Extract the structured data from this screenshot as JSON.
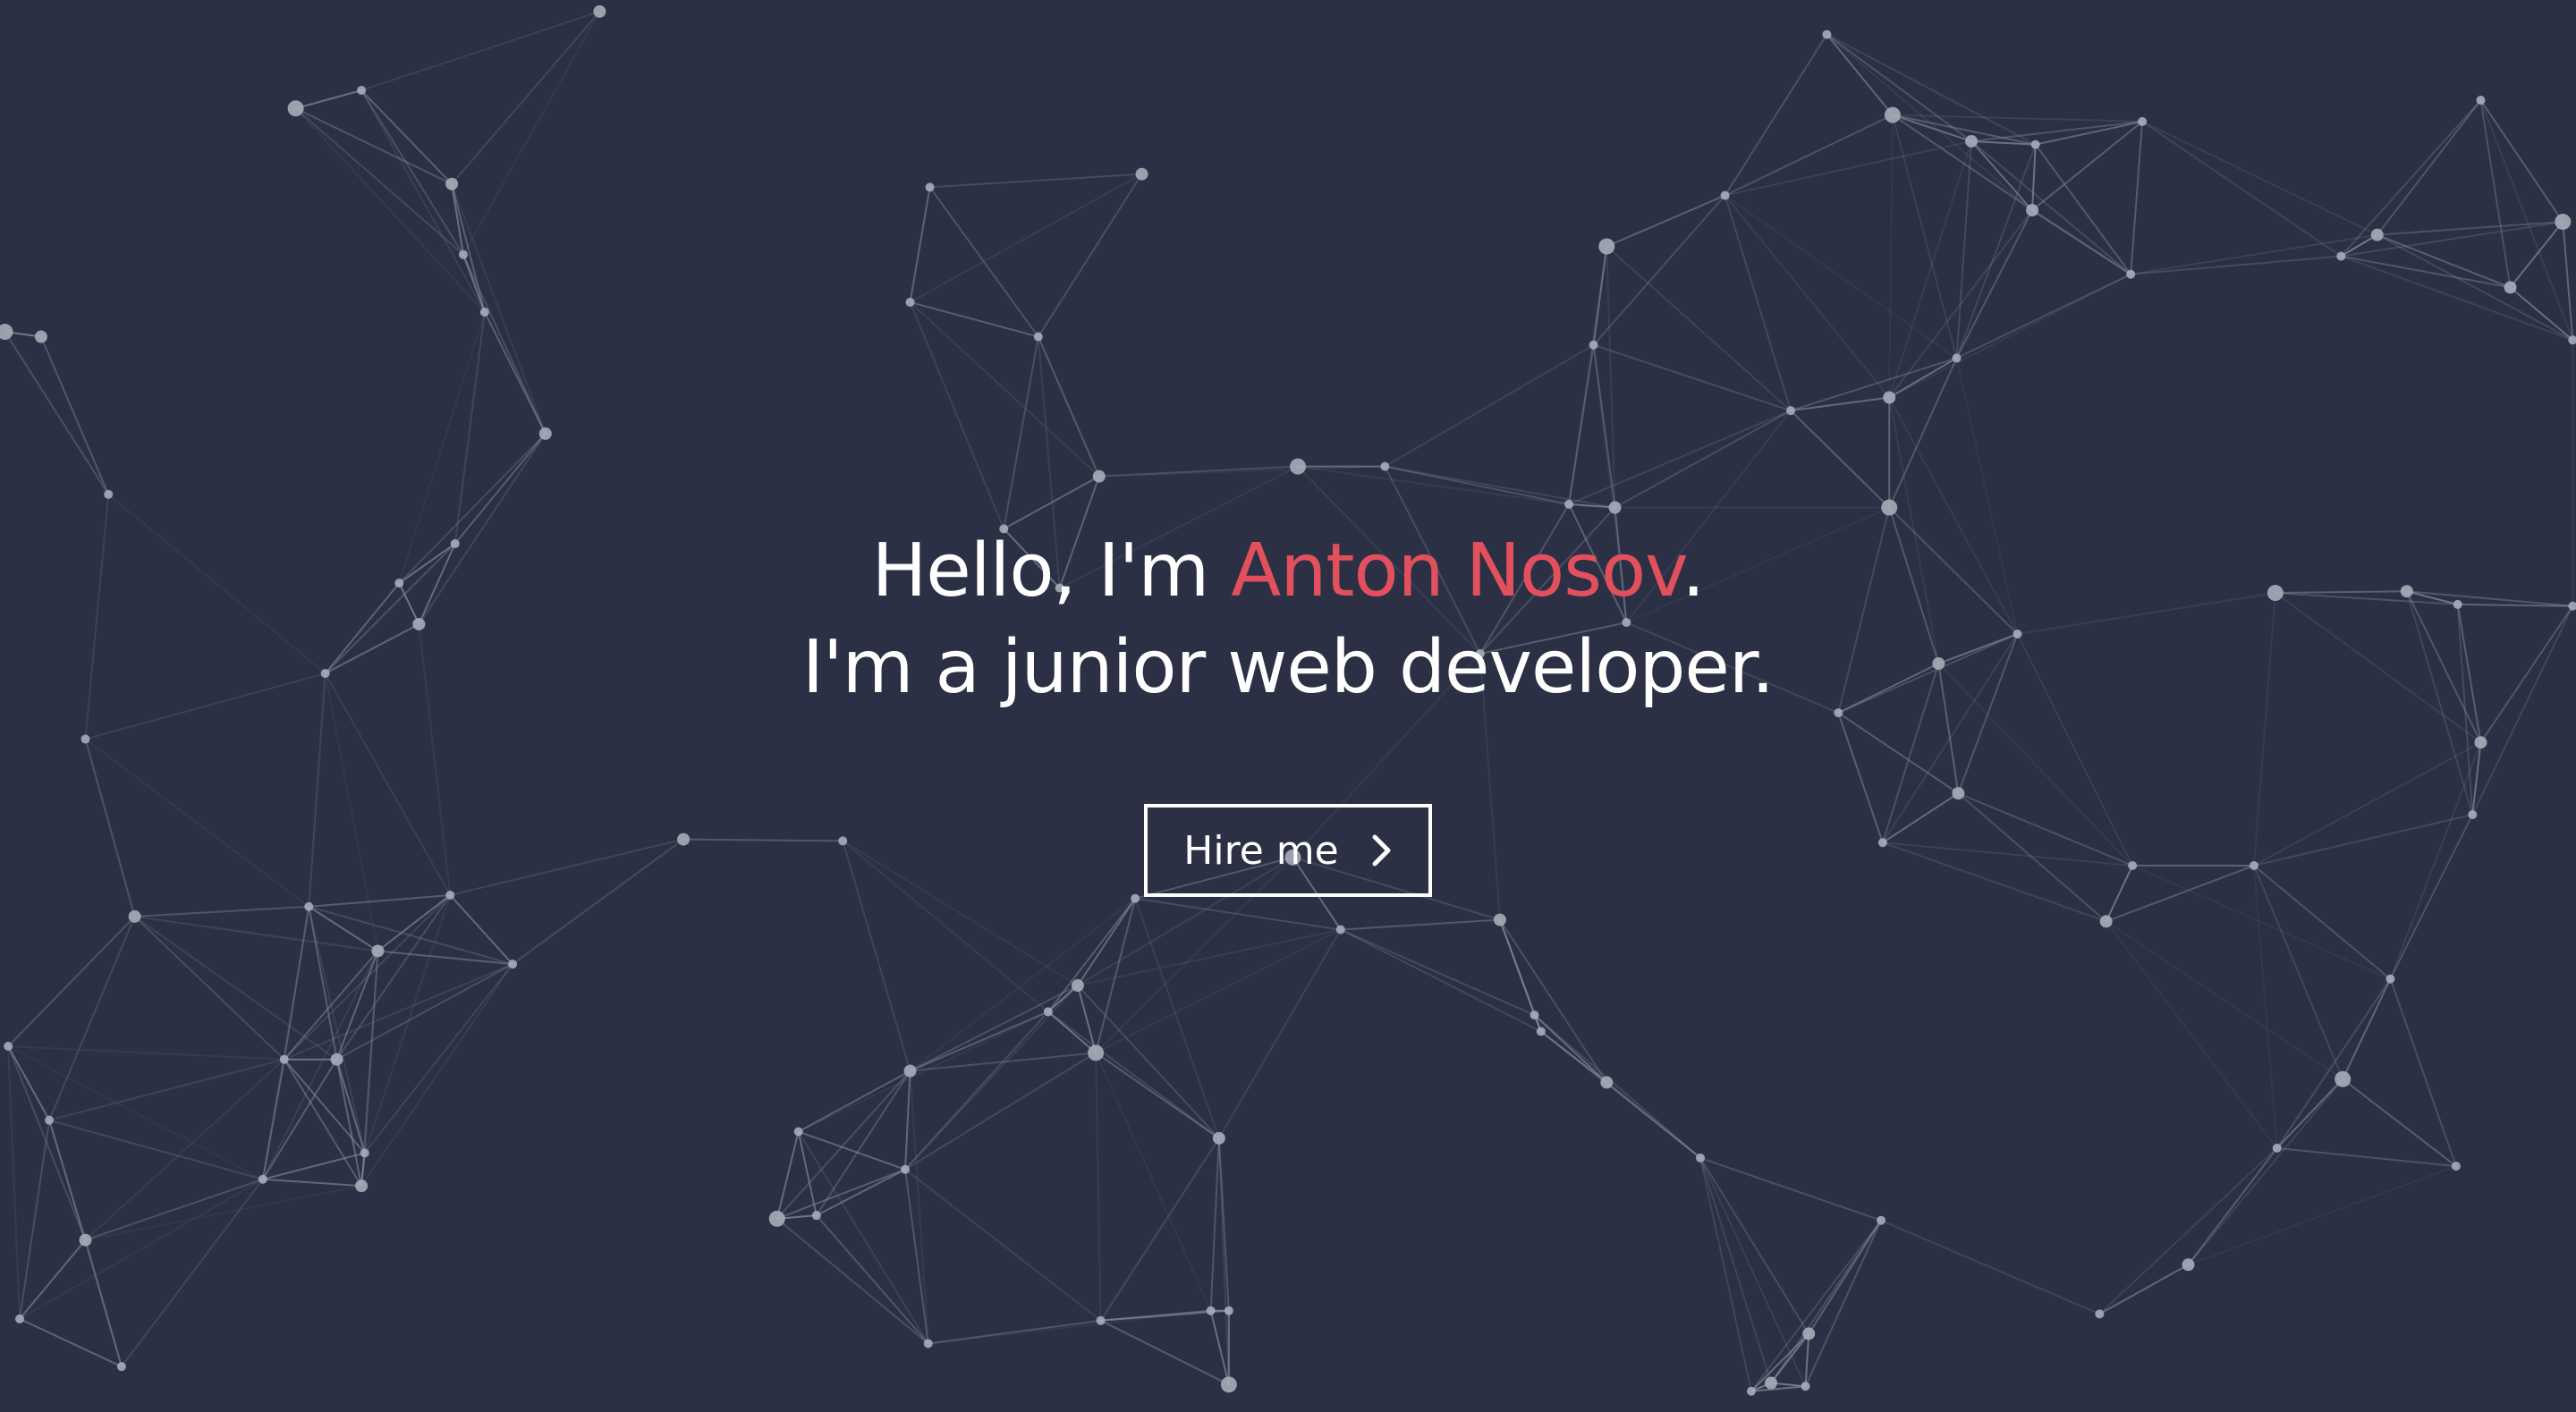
{
  "hero": {
    "greeting_prefix": "Hello, I'm ",
    "name": "Anton Nosov",
    "greeting_suffix": ".",
    "tagline": "I'm a junior web developer.",
    "cta_label": "Hire me",
    "cta_icon": "chevron-right-icon"
  },
  "theme": {
    "background": "#2b3044",
    "accent": "#e2505d",
    "text": "#ffffff",
    "node_color": "#a9acb8",
    "line_color": "#8d91a2"
  }
}
